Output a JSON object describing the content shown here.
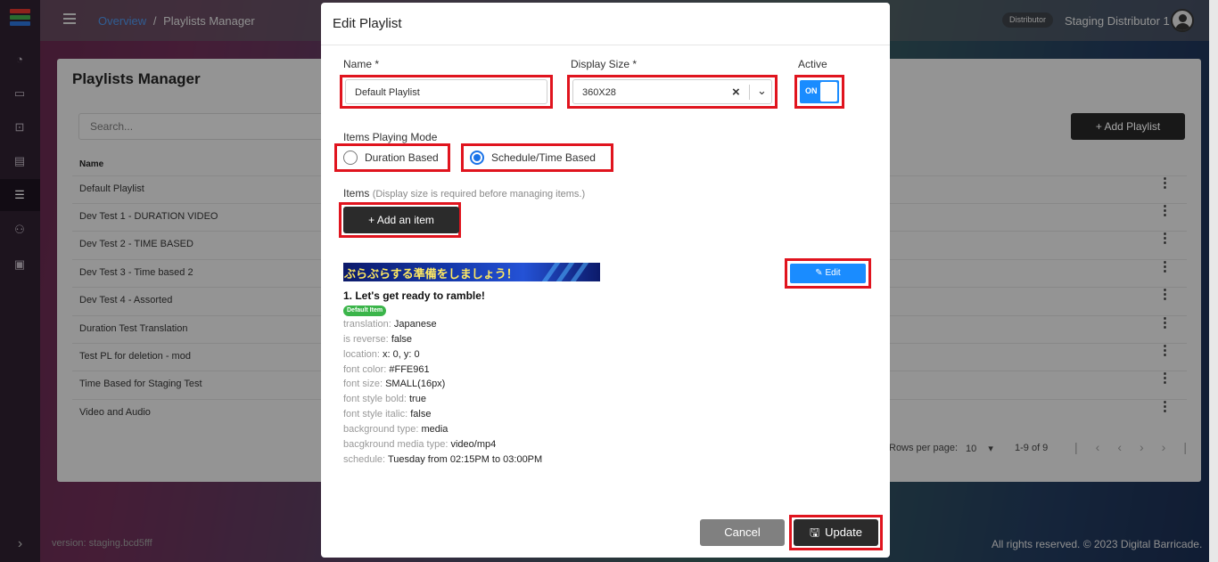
{
  "topbar": {
    "breadcrumb_link": "Overview",
    "breadcrumb_sep": "/",
    "breadcrumb_current": "Playlists Manager",
    "role_badge": "Distributor",
    "user_name": "Staging Distributor 1"
  },
  "manager": {
    "title": "Playlists Manager",
    "search_placeholder": "Search...",
    "add_button": "+ Add Playlist",
    "column_name": "Name",
    "rows": [
      "Default Playlist",
      "Dev Test 1 - DURATION VIDEO",
      "Dev Test 2 - TIME BASED",
      "Dev Test 3 - Time based 2",
      "Dev Test 4 - Assorted",
      "Duration Test Translation",
      "Test PL for deletion - mod",
      "Time Based for Staging Test",
      "Video and Audio"
    ],
    "rows_per_page_label": "Rows per page:",
    "rows_per_page_value": "10",
    "range": "1-9 of 9"
  },
  "footer": {
    "version": "version: staging.bcd5fff",
    "copyright": "All rights reserved. © 2023 Digital Barricade."
  },
  "modal": {
    "title": "Edit Playlist",
    "name_label": "Name *",
    "name_value": "Default Playlist",
    "display_size_label": "Display Size *",
    "display_size_value": "360X28",
    "active_label": "Active",
    "active_toggle": "ON",
    "mode_label": "Items Playing Mode",
    "mode_duration": "Duration Based",
    "mode_schedule": "Schedule/Time Based",
    "items_label": "Items",
    "items_hint": "(Display size is required before managing items.)",
    "add_item_button": "+ Add an item",
    "banner_text": "ぶらぶらする準備をしましょう！",
    "edit_button": "Edit",
    "item_title": "1. Let's get ready to ramble!",
    "item_badge": "Default Item",
    "properties": [
      {
        "key": "translation:",
        "value": "Japanese"
      },
      {
        "key": "is reverse:",
        "value": "false"
      },
      {
        "key": "location:",
        "value": "x: 0, y: 0"
      },
      {
        "key": "font color:",
        "value": "#FFE961"
      },
      {
        "key": "font size:",
        "value": "SMALL(16px)"
      },
      {
        "key": "font style bold:",
        "value": "true"
      },
      {
        "key": "font style italic:",
        "value": "false"
      },
      {
        "key": "background type:",
        "value": "media"
      },
      {
        "key": "bacgkround media type:",
        "value": "video/mp4"
      },
      {
        "key": "schedule:",
        "value": "Tuesday from 02:15PM to 03:00PM"
      }
    ],
    "cancel_button": "Cancel",
    "update_button": "Update"
  },
  "colors": {
    "accent_blue": "#1a8cff",
    "highlight_red": "#e0141e",
    "badge_green": "#3bb54a",
    "banner_text": "#FFE961"
  }
}
